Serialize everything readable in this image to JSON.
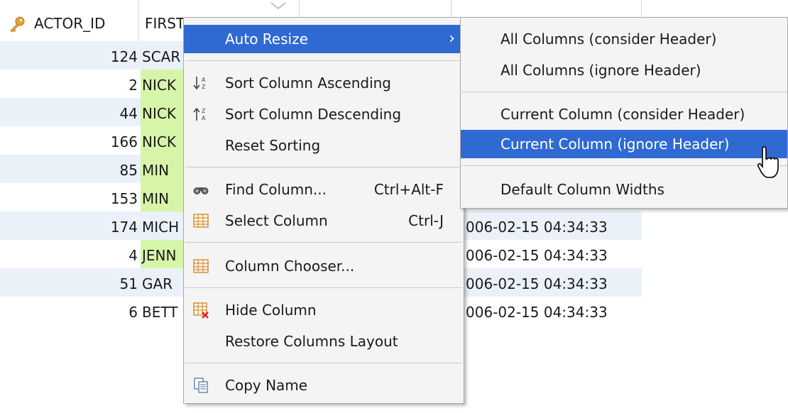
{
  "grid": {
    "columns": [
      {
        "label": "ACTOR_ID",
        "key_icon": "key-icon"
      },
      {
        "label": "FIRST"
      },
      {
        "label": ""
      },
      {
        "label": ""
      },
      {
        "label": ""
      }
    ],
    "rows": [
      {
        "actor_id": "124",
        "first": "SCAR",
        "highlight": false,
        "last_update": ""
      },
      {
        "actor_id": "2",
        "first": "NICK",
        "highlight": true,
        "last_update": ""
      },
      {
        "actor_id": "44",
        "first": "NICK",
        "highlight": true,
        "last_update": ""
      },
      {
        "actor_id": "166",
        "first": "NICK",
        "highlight": true,
        "last_update": ""
      },
      {
        "actor_id": "85",
        "first": "MIN",
        "highlight": true,
        "last_update": ""
      },
      {
        "actor_id": "153",
        "first": "MIN",
        "highlight": true,
        "last_update": ""
      },
      {
        "actor_id": "174",
        "first": "MICH",
        "highlight": false,
        "last_update": "006-02-15 04:34:33"
      },
      {
        "actor_id": "4",
        "first": "JENN",
        "highlight": true,
        "last_update": "006-02-15 04:34:33"
      },
      {
        "actor_id": "51",
        "first": "GAR",
        "highlight": false,
        "last_update": "006-02-15 04:34:33"
      },
      {
        "actor_id": "6",
        "first": "BETT",
        "highlight": false,
        "last_update": "006-02-15 04:34:33"
      }
    ]
  },
  "context_menu": {
    "items": [
      {
        "label": "Auto Resize",
        "shortcut": "",
        "icon": "",
        "submenu_arrow": "›"
      },
      {
        "label": "Sort Column Ascending",
        "shortcut": "",
        "icon": "sort-ascending-icon"
      },
      {
        "label": "Sort Column Descending",
        "shortcut": "",
        "icon": "sort-descending-icon"
      },
      {
        "label": "Reset Sorting",
        "shortcut": "",
        "icon": ""
      },
      {
        "label": "Find Column...",
        "shortcut": "Ctrl+Alt-F",
        "icon": "binoculars-icon"
      },
      {
        "label": "Select Column",
        "shortcut": "Ctrl-J",
        "icon": "table-column-icon"
      },
      {
        "label": "Column Chooser...",
        "shortcut": "",
        "icon": "column-chooser-icon"
      },
      {
        "label": "Hide Column",
        "shortcut": "",
        "icon": "hide-column-icon"
      },
      {
        "label": "Restore Columns Layout",
        "shortcut": "",
        "icon": ""
      },
      {
        "label": "Copy Name",
        "shortcut": "",
        "icon": "copy-icon"
      }
    ]
  },
  "submenu": {
    "items": [
      {
        "label": "All Columns (consider Header)"
      },
      {
        "label": "All Columns (ignore Header)"
      },
      {
        "label": "Current Column (consider Header)"
      },
      {
        "label": "Current Column (ignore Header)"
      },
      {
        "label": "Default Column Widths"
      }
    ]
  },
  "colors": {
    "selection": "#2f6ad3",
    "highlight_cell": "#d7f5a8",
    "alt_row": "#eaf1f8",
    "menu_bg": "#f4f4f4"
  }
}
